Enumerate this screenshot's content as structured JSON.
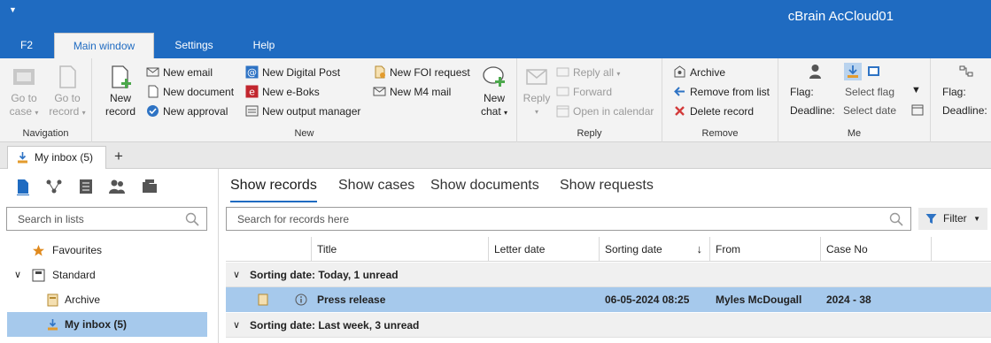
{
  "window": {
    "title": "cBrain AcCloud01",
    "quick_access_icon": "dropdown-caret-icon"
  },
  "menu": {
    "tabs": [
      "F2",
      "Main window",
      "Settings",
      "Help"
    ],
    "active": "Main window"
  },
  "ribbon": {
    "navigation": {
      "label": "Navigation",
      "go_to_case": [
        "Go to",
        "case"
      ],
      "go_to_record": [
        "Go to",
        "record"
      ]
    },
    "new": {
      "label": "New",
      "new_record": [
        "New",
        "record"
      ],
      "new_email": "New email",
      "new_document": "New document",
      "new_approval": "New approval",
      "new_digital_post": "New Digital Post",
      "new_eboks": "New e-Boks",
      "new_output_manager": "New output manager",
      "new_foi_request": "New FOI request",
      "new_m4_mail": "New M4 mail",
      "new_chat": [
        "New",
        "chat"
      ]
    },
    "reply": {
      "label": "Reply",
      "reply": "Reply",
      "reply_all": "Reply all",
      "forward": "Forward",
      "open_in_calendar": "Open in calendar"
    },
    "remove": {
      "label": "Remove",
      "archive": "Archive",
      "remove_from_list": "Remove from list",
      "delete_record": "Delete record"
    },
    "me": {
      "label": "Me",
      "flag_label": "Flag:",
      "flag_value": "Select flag",
      "deadline_label": "Deadline:",
      "deadline_value": "Select date"
    },
    "extra": {
      "flag_label": "Flag:",
      "deadline_label": "Deadline:"
    }
  },
  "doc_tab": {
    "label": "My inbox (5)",
    "add": "+"
  },
  "left_panel": {
    "search_placeholder": "Search in lists",
    "tree": {
      "favourites": "Favourites",
      "standard": "Standard",
      "archive": "Archive",
      "my_inbox": "My inbox (5)"
    }
  },
  "main": {
    "view_tabs": [
      "Show records",
      "Show cases",
      "Show documents",
      "Show requests"
    ],
    "search_placeholder": "Search for records here",
    "filter_label": "Filter",
    "columns": [
      "Title",
      "Letter date",
      "Sorting date",
      "From",
      "Case No"
    ],
    "sort_arrow": "↓",
    "groups": [
      {
        "label": "Sorting date: Today, 1 unread"
      },
      {
        "label": "Sorting date: Last week, 3 unread"
      }
    ],
    "records": [
      {
        "title": "Press release",
        "letter_date": "",
        "sorting_date": "06-05-2024 08:25",
        "from": "Myles McDougall",
        "case_no": "2024 - 38"
      }
    ]
  },
  "colors": {
    "brand_blue": "#1f6bc1",
    "selection": "#a6c9ec"
  }
}
